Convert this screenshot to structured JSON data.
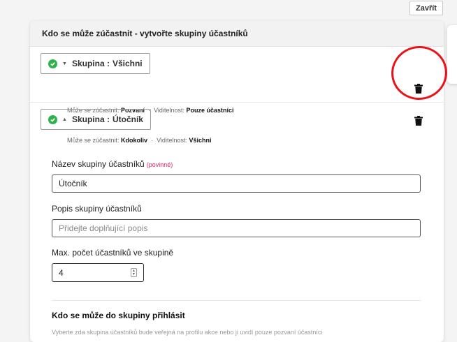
{
  "close_button": {
    "label": "Zavřít"
  },
  "card": {
    "title": "Kdo se může zúčastnit - vytvořte skupiny účastníků"
  },
  "groups": [
    {
      "label": "Skupina :",
      "name": "Všichni",
      "expanded": false,
      "who_label": "Může se zúčastnit:",
      "who_value": "Pozvaní",
      "separator": "·",
      "visibility_label": "Viditelnost:",
      "visibility_value": "Pouze účastníci"
    },
    {
      "label": "Skupina :",
      "name": "Útočník",
      "expanded": true,
      "who_label": "Může se zúčastnit:",
      "who_value": "Kdokoliv",
      "separator": "·",
      "visibility_label": "Viditelnost:",
      "visibility_value": "Všichni"
    }
  ],
  "form": {
    "name_label": "Název skupiny účastníků",
    "required_note": "(povinné)",
    "name_value": "Útočník",
    "desc_label": "Popis skupiny účastníků",
    "desc_placeholder": "Přidejte doplňující popis",
    "max_label": "Max. počet účastníků ve skupině",
    "max_value": "4",
    "section_title": "Kdo se může do skupiny přihlásit",
    "section_desc": "Vyberte zda skupina účastníků bude veřejná na profilu akce nebo ji uvidí pouze pozvaní účastníci"
  },
  "icons": {
    "status": "check-circle-icon",
    "collapsed": "caret-down-icon",
    "expanded": "caret-up-icon",
    "delete": "trash-icon"
  },
  "colors": {
    "check": "#2fb24c",
    "required": "#e0245e",
    "annotation": "#e8141a"
  }
}
